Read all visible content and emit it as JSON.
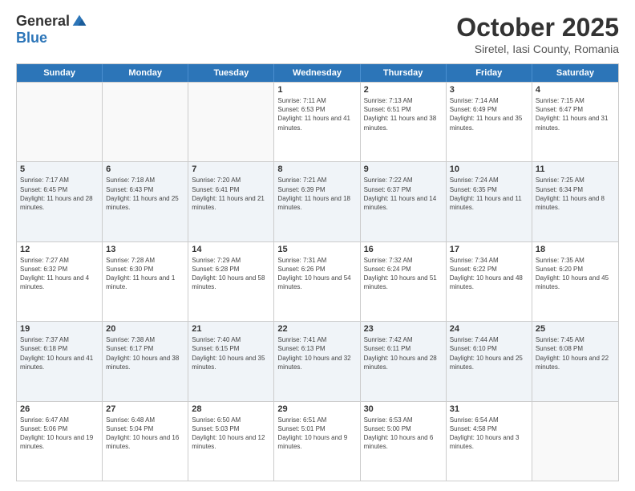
{
  "header": {
    "logo_general": "General",
    "logo_blue": "Blue",
    "month_title": "October 2025",
    "subtitle": "Siretel, Iasi County, Romania"
  },
  "days_of_week": [
    "Sunday",
    "Monday",
    "Tuesday",
    "Wednesday",
    "Thursday",
    "Friday",
    "Saturday"
  ],
  "weeks": [
    [
      {
        "day": "",
        "info": ""
      },
      {
        "day": "",
        "info": ""
      },
      {
        "day": "",
        "info": ""
      },
      {
        "day": "1",
        "info": "Sunrise: 7:11 AM\nSunset: 6:53 PM\nDaylight: 11 hours and 41 minutes."
      },
      {
        "day": "2",
        "info": "Sunrise: 7:13 AM\nSunset: 6:51 PM\nDaylight: 11 hours and 38 minutes."
      },
      {
        "day": "3",
        "info": "Sunrise: 7:14 AM\nSunset: 6:49 PM\nDaylight: 11 hours and 35 minutes."
      },
      {
        "day": "4",
        "info": "Sunrise: 7:15 AM\nSunset: 6:47 PM\nDaylight: 11 hours and 31 minutes."
      }
    ],
    [
      {
        "day": "5",
        "info": "Sunrise: 7:17 AM\nSunset: 6:45 PM\nDaylight: 11 hours and 28 minutes."
      },
      {
        "day": "6",
        "info": "Sunrise: 7:18 AM\nSunset: 6:43 PM\nDaylight: 11 hours and 25 minutes."
      },
      {
        "day": "7",
        "info": "Sunrise: 7:20 AM\nSunset: 6:41 PM\nDaylight: 11 hours and 21 minutes."
      },
      {
        "day": "8",
        "info": "Sunrise: 7:21 AM\nSunset: 6:39 PM\nDaylight: 11 hours and 18 minutes."
      },
      {
        "day": "9",
        "info": "Sunrise: 7:22 AM\nSunset: 6:37 PM\nDaylight: 11 hours and 14 minutes."
      },
      {
        "day": "10",
        "info": "Sunrise: 7:24 AM\nSunset: 6:35 PM\nDaylight: 11 hours and 11 minutes."
      },
      {
        "day": "11",
        "info": "Sunrise: 7:25 AM\nSunset: 6:34 PM\nDaylight: 11 hours and 8 minutes."
      }
    ],
    [
      {
        "day": "12",
        "info": "Sunrise: 7:27 AM\nSunset: 6:32 PM\nDaylight: 11 hours and 4 minutes."
      },
      {
        "day": "13",
        "info": "Sunrise: 7:28 AM\nSunset: 6:30 PM\nDaylight: 11 hours and 1 minute."
      },
      {
        "day": "14",
        "info": "Sunrise: 7:29 AM\nSunset: 6:28 PM\nDaylight: 10 hours and 58 minutes."
      },
      {
        "day": "15",
        "info": "Sunrise: 7:31 AM\nSunset: 6:26 PM\nDaylight: 10 hours and 54 minutes."
      },
      {
        "day": "16",
        "info": "Sunrise: 7:32 AM\nSunset: 6:24 PM\nDaylight: 10 hours and 51 minutes."
      },
      {
        "day": "17",
        "info": "Sunrise: 7:34 AM\nSunset: 6:22 PM\nDaylight: 10 hours and 48 minutes."
      },
      {
        "day": "18",
        "info": "Sunrise: 7:35 AM\nSunset: 6:20 PM\nDaylight: 10 hours and 45 minutes."
      }
    ],
    [
      {
        "day": "19",
        "info": "Sunrise: 7:37 AM\nSunset: 6:18 PM\nDaylight: 10 hours and 41 minutes."
      },
      {
        "day": "20",
        "info": "Sunrise: 7:38 AM\nSunset: 6:17 PM\nDaylight: 10 hours and 38 minutes."
      },
      {
        "day": "21",
        "info": "Sunrise: 7:40 AM\nSunset: 6:15 PM\nDaylight: 10 hours and 35 minutes."
      },
      {
        "day": "22",
        "info": "Sunrise: 7:41 AM\nSunset: 6:13 PM\nDaylight: 10 hours and 32 minutes."
      },
      {
        "day": "23",
        "info": "Sunrise: 7:42 AM\nSunset: 6:11 PM\nDaylight: 10 hours and 28 minutes."
      },
      {
        "day": "24",
        "info": "Sunrise: 7:44 AM\nSunset: 6:10 PM\nDaylight: 10 hours and 25 minutes."
      },
      {
        "day": "25",
        "info": "Sunrise: 7:45 AM\nSunset: 6:08 PM\nDaylight: 10 hours and 22 minutes."
      }
    ],
    [
      {
        "day": "26",
        "info": "Sunrise: 6:47 AM\nSunset: 5:06 PM\nDaylight: 10 hours and 19 minutes."
      },
      {
        "day": "27",
        "info": "Sunrise: 6:48 AM\nSunset: 5:04 PM\nDaylight: 10 hours and 16 minutes."
      },
      {
        "day": "28",
        "info": "Sunrise: 6:50 AM\nSunset: 5:03 PM\nDaylight: 10 hours and 12 minutes."
      },
      {
        "day": "29",
        "info": "Sunrise: 6:51 AM\nSunset: 5:01 PM\nDaylight: 10 hours and 9 minutes."
      },
      {
        "day": "30",
        "info": "Sunrise: 6:53 AM\nSunset: 5:00 PM\nDaylight: 10 hours and 6 minutes."
      },
      {
        "day": "31",
        "info": "Sunrise: 6:54 AM\nSunset: 4:58 PM\nDaylight: 10 hours and 3 minutes."
      },
      {
        "day": "",
        "info": ""
      }
    ]
  ]
}
